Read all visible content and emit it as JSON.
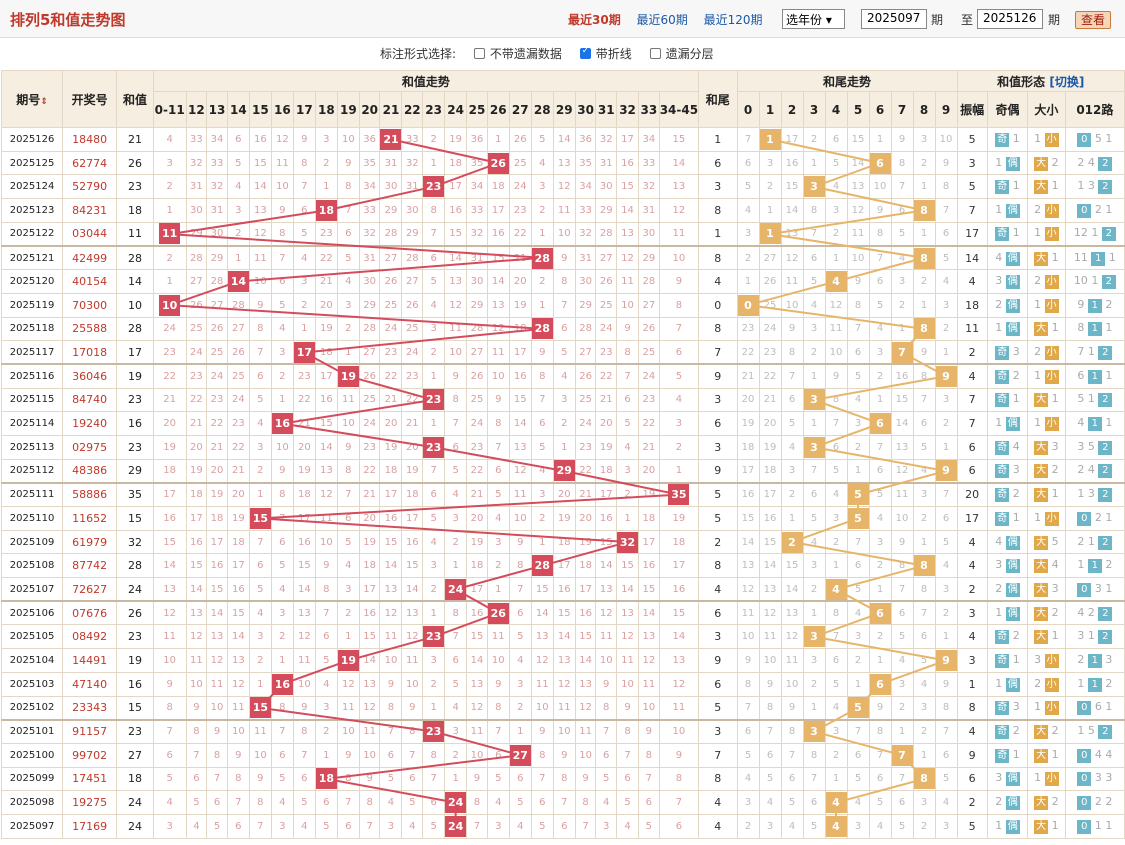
{
  "header": {
    "title": "排列5和值走势图",
    "periods": [
      "最近30期",
      "最近60期",
      "最近120期"
    ],
    "active_period": 0,
    "year_select": "选年份",
    "from": "2025097",
    "from_unit": "期",
    "to_label": "至",
    "to": "2025126",
    "to_unit": "期",
    "query": "查看"
  },
  "options": {
    "label": "标注形式选择:",
    "items": [
      {
        "label": "不带遗漏数据",
        "checked": false
      },
      {
        "label": "带折线",
        "checked": true
      },
      {
        "label": "遗漏分层",
        "checked": false
      }
    ]
  },
  "columns": {
    "issue": "期号",
    "draw": "开奖号",
    "sum": "和值",
    "sum_trend": "和值走势",
    "sum_bins": [
      "0-11",
      "12",
      "13",
      "14",
      "15",
      "16",
      "17",
      "18",
      "19",
      "20",
      "21",
      "22",
      "23",
      "24",
      "25",
      "26",
      "27",
      "28",
      "29",
      "30",
      "31",
      "32",
      "33",
      "34-45"
    ],
    "tail": "和尾",
    "tail_trend": "和尾走势",
    "tails": [
      "0",
      "1",
      "2",
      "3",
      "4",
      "5",
      "6",
      "7",
      "8",
      "9"
    ],
    "form": "和值形态",
    "switch": "[切换]",
    "amp": "振幅",
    "odd_even": "奇偶",
    "big_small": "大小",
    "route": "012路",
    "tag_odd": "奇",
    "tag_even": "偶",
    "tag_big": "大",
    "tag_small": "小"
  },
  "rows": [
    {
      "issue": "2025126",
      "draw": "18480",
      "sum": 21,
      "amp": 5
    },
    {
      "issue": "2025125",
      "draw": "62774",
      "sum": 26,
      "amp": 3
    },
    {
      "issue": "2025124",
      "draw": "52790",
      "sum": 23,
      "amp": 5
    },
    {
      "issue": "2025123",
      "draw": "84231",
      "sum": 18,
      "amp": 7
    },
    {
      "issue": "2025122",
      "draw": "03044",
      "sum": 11,
      "amp": 17
    },
    {
      "issue": "2025121",
      "draw": "42499",
      "sum": 28,
      "amp": 14
    },
    {
      "issue": "2025120",
      "draw": "40154",
      "sum": 14,
      "amp": 4
    },
    {
      "issue": "2025119",
      "draw": "70300",
      "sum": 10,
      "amp": 18
    },
    {
      "issue": "2025118",
      "draw": "25588",
      "sum": 28,
      "amp": 11
    },
    {
      "issue": "2025117",
      "draw": "17018",
      "sum": 17,
      "amp": 2
    },
    {
      "issue": "2025116",
      "draw": "36046",
      "sum": 19,
      "amp": 4
    },
    {
      "issue": "2025115",
      "draw": "84740",
      "sum": 23,
      "amp": 7
    },
    {
      "issue": "2025114",
      "draw": "19240",
      "sum": 16,
      "amp": 7
    },
    {
      "issue": "2025113",
      "draw": "02975",
      "sum": 23,
      "amp": 6
    },
    {
      "issue": "2025112",
      "draw": "48386",
      "sum": 29,
      "amp": 6
    },
    {
      "issue": "2025111",
      "draw": "58886",
      "sum": 35,
      "amp": 20
    },
    {
      "issue": "2025110",
      "draw": "11652",
      "sum": 15,
      "amp": 17
    },
    {
      "issue": "2025109",
      "draw": "61979",
      "sum": 32,
      "amp": 4
    },
    {
      "issue": "2025108",
      "draw": "87742",
      "sum": 28,
      "amp": 4
    },
    {
      "issue": "2025107",
      "draw": "72627",
      "sum": 24,
      "amp": 2
    },
    {
      "issue": "2025106",
      "draw": "07676",
      "sum": 26,
      "amp": 3
    },
    {
      "issue": "2025105",
      "draw": "08492",
      "sum": 23,
      "amp": 4
    },
    {
      "issue": "2025104",
      "draw": "14491",
      "sum": 19,
      "amp": 3
    },
    {
      "issue": "2025103",
      "draw": "47140",
      "sum": 16,
      "amp": 1
    },
    {
      "issue": "2025102",
      "draw": "23343",
      "sum": 15,
      "amp": 8
    },
    {
      "issue": "2025101",
      "draw": "91157",
      "sum": 23,
      "amp": 4
    },
    {
      "issue": "2025100",
      "draw": "99702",
      "sum": 27,
      "amp": 9
    },
    {
      "issue": "2025099",
      "draw": "17451",
      "sum": 18,
      "amp": 6
    },
    {
      "issue": "2025098",
      "draw": "19275",
      "sum": 24,
      "amp": 2
    },
    {
      "issue": "2025097",
      "draw": "17169",
      "sum": 24,
      "amp": 5
    }
  ],
  "colors": {
    "hit": "#d44c5c",
    "tail": "#e6b56a",
    "title": "#c0392b",
    "link": "#1a57a8"
  }
}
